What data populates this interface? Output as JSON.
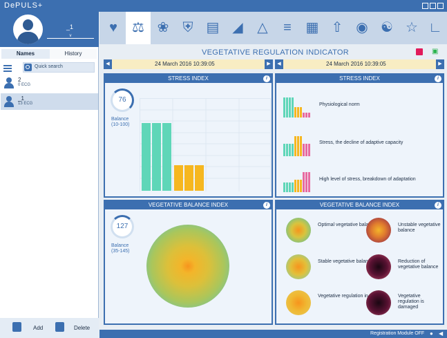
{
  "app": {
    "logo": "DePULS+"
  },
  "user": {
    "name": "_1",
    "selector": "v"
  },
  "tabs": {
    "names": "Names",
    "history": "History"
  },
  "search": {
    "placeholder": "Quick search"
  },
  "patients": [
    {
      "name": "2",
      "ecg": "0 ECG"
    },
    {
      "name": "_1",
      "ecg": "13 ECG"
    }
  ],
  "footer": {
    "add": "Add",
    "delete": "Delete"
  },
  "nav_icons": [
    "heart-icon",
    "scales-icon",
    "brain-icon",
    "shield-icon",
    "stairs-icon",
    "lung-icon",
    "lungs-icon",
    "spine-icon",
    "chart-icon",
    "arrow-up-icon",
    "target-icon",
    "yinyang-icon",
    "star-icon",
    "graph-icon"
  ],
  "page": {
    "title": "VEGETATIVE REGULATION INDICATOR"
  },
  "left": {
    "date": "24 March 2016 10:39:05"
  },
  "right": {
    "date": "24 March 2016 10:39:05"
  },
  "stress": {
    "title": "STRESS INDEX",
    "value": "76",
    "balance_label": "Balance",
    "range": "(10-100)"
  },
  "vbi": {
    "title": "VEGETATIVE BALANCE INDEX",
    "value": "127",
    "balance_label": "Balance",
    "range": "(35-145)"
  },
  "stress_legend": {
    "title": "STRESS INDEX",
    "items": [
      "Physiological norm",
      "Stress, the decline of adaptive capacity",
      "High level of stress, breakdown of adaptation"
    ]
  },
  "vbi_legend": {
    "title": "VEGETATIVE BALANCE INDEX",
    "items": [
      "Optimal vegetative balance",
      "Unstable vegetative balance",
      "Stable vegetative balance",
      "Reduction of vegetative balance",
      "Vegetative regulation in norm",
      "Vegetative regulation is damaged"
    ]
  },
  "status": {
    "text": "Registration Module OFF"
  },
  "colors": {
    "brand": "#3c6fb0",
    "green": "#5fd6b8",
    "amber": "#f6b720",
    "pink": "#e86aa0",
    "date_bar": "#f8edc3"
  }
}
